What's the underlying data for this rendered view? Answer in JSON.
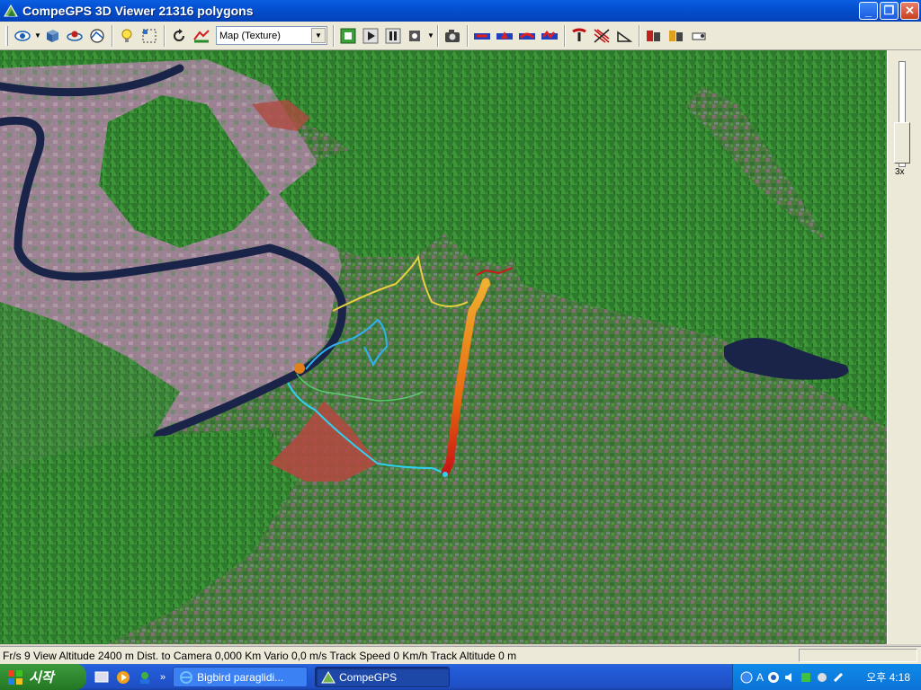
{
  "window": {
    "title": "CompeGPS 3D Viewer 21316 polygons"
  },
  "toolbar": {
    "map_select_value": "Map (Texture)"
  },
  "right_panel": {
    "zoom_label": "3x"
  },
  "status": {
    "text": "Fr/s 9 View Altitude 2400 m Dist. to Camera 0,000 Km Vario 0,0 m/s Track Speed 0 Km/h Track Altitude 0 m"
  },
  "taskbar": {
    "start_label": "시작",
    "tasks": [
      {
        "label": "Bigbird paraglidi..."
      },
      {
        "label": "CompeGPS"
      }
    ],
    "clock": "오후 4:18",
    "tray_letter": "A"
  },
  "colors": {
    "track_orange": "#f08a1a",
    "track_red": "#d81818",
    "track_yellow": "#e8d040",
    "track_cyan": "#30d0f0",
    "river": "#1a2448"
  }
}
